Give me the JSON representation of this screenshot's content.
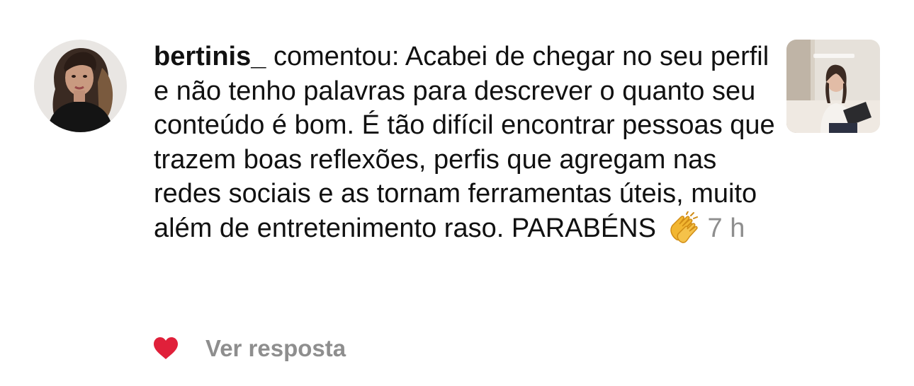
{
  "comment": {
    "username": "bertinis_",
    "text": " comentou: Acabei de chegar no seu perfil e não tenho palavras para descrever o quanto seu conteúdo é bom. É tão difícil encontrar pessoas que trazem boas reflexões, perfis que agregam nas redes sociais e as tornam ferramentas úteis, muito além de entretenimento raso. PARABÉNS",
    "emoji": "clapping-hands-emoji",
    "time": "7 h"
  },
  "actions": {
    "like_icon": "heart-icon",
    "like_color": "#e0203a",
    "reply_label": "Ver resposta"
  },
  "colors": {
    "text": "#111111",
    "muted": "#8e8e8e"
  }
}
